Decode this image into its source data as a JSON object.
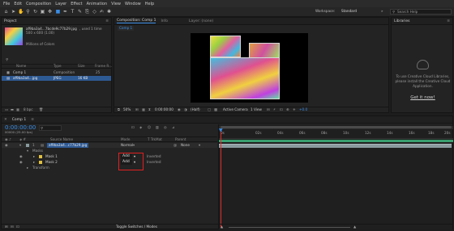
{
  "menu": [
    "File",
    "Edit",
    "Composition",
    "Layer",
    "Effect",
    "Animation",
    "View",
    "Window",
    "Help"
  ],
  "workspace": {
    "label": "Workspace:",
    "value": "Standard"
  },
  "search_help": "Search Help",
  "project": {
    "tab": "Project",
    "file_name": "af9ba3a4...7bcde9c77b29.jpg",
    "file_used": ", used 1 time",
    "file_dims": "500 x 600 (1.00)",
    "file_colors": "Millions of Colors",
    "columns": [
      "Name",
      "Type",
      "Size",
      "Frame R..."
    ],
    "items": [
      {
        "name": "Comp 1",
        "type": "Composition",
        "size": "",
        "rate": "25"
      },
      {
        "name": "af9ba3a4...jpg",
        "type": "JPEG",
        "size": "16 KB",
        "rate": ""
      }
    ],
    "bpc": "8 bpc"
  },
  "composition": {
    "tab": "Composition: Comp 1",
    "tab2": "Info",
    "tab3": "Layer: (none)",
    "comp_label": "Comp 1",
    "zoom": "50%",
    "timecode": "0:00:00:00",
    "resolution": "(Half)",
    "camera": "Active Camera",
    "views": "1 View",
    "offset": "+0.0"
  },
  "libraries": {
    "tab": "Libraries",
    "message": "To use Creative Cloud Libraries, please install the Creative Cloud Application.",
    "link": "Get it now!"
  },
  "timeline": {
    "tab": "Comp 1",
    "timecode": "0:00:00:00",
    "fps": "00000 (25.00 fps)",
    "columns": {
      "source": "Source Name",
      "mode": "Mode",
      "trkmat": "T TrkMat",
      "parent": "Parent"
    },
    "layer": {
      "num": "1",
      "name": "af9ba3a4...c77b29.jpg",
      "mode": "Normal",
      "parent": "None"
    },
    "masks_label": "Masks",
    "masks": [
      {
        "name": "Mask 1",
        "mode": "Add",
        "inverted": "Inverted"
      },
      {
        "name": "Mask 2",
        "mode": "Add",
        "inverted": "Inverted"
      }
    ],
    "transform_label": "Transform",
    "ruler": [
      "0s",
      "02s",
      "04s",
      "06s",
      "08s",
      "10s",
      "12s",
      "14s",
      "16s",
      "18s",
      "20s"
    ],
    "toggle": "Toggle Switches / Modes"
  },
  "colors": {
    "accent": "#3a8ee6",
    "highlight_box": "#e02020",
    "layer_bar": "#8a9a9e"
  }
}
